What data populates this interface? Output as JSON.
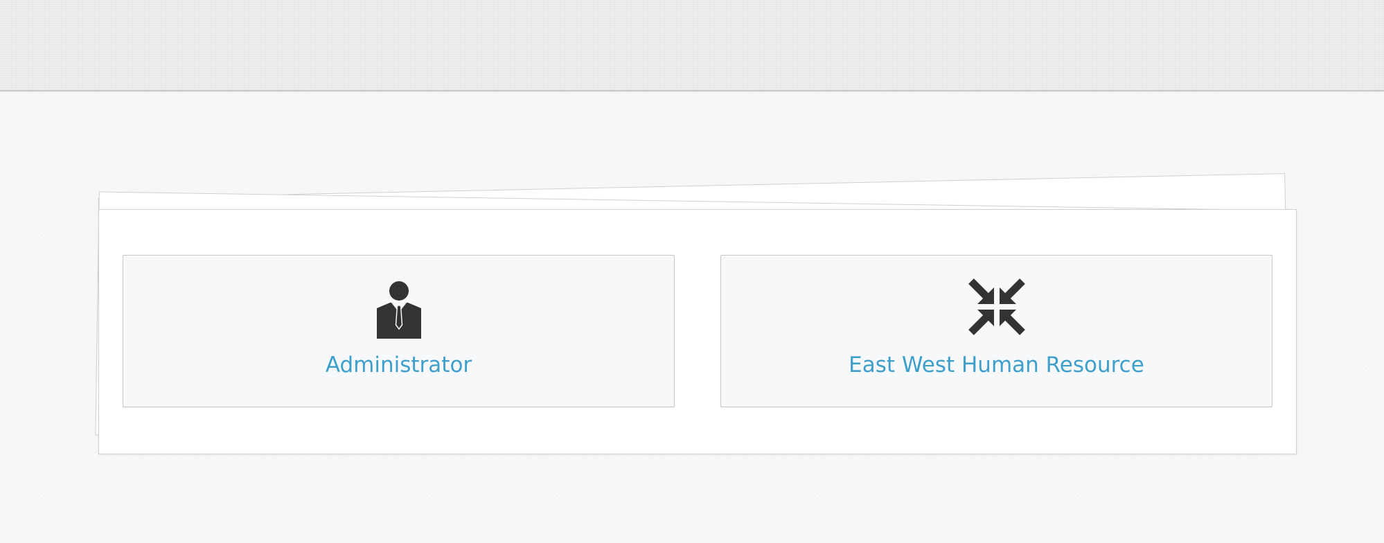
{
  "colors": {
    "link": "#3e9fca",
    "icon": "#333333",
    "tile_background": "#f6f8fa",
    "header_background": "#ebebeb"
  },
  "roles": [
    {
      "label": "Administrator",
      "icon": "user-tie-icon"
    },
    {
      "label": "East West Human Resource",
      "icon": "compress-arrows-icon"
    }
  ]
}
